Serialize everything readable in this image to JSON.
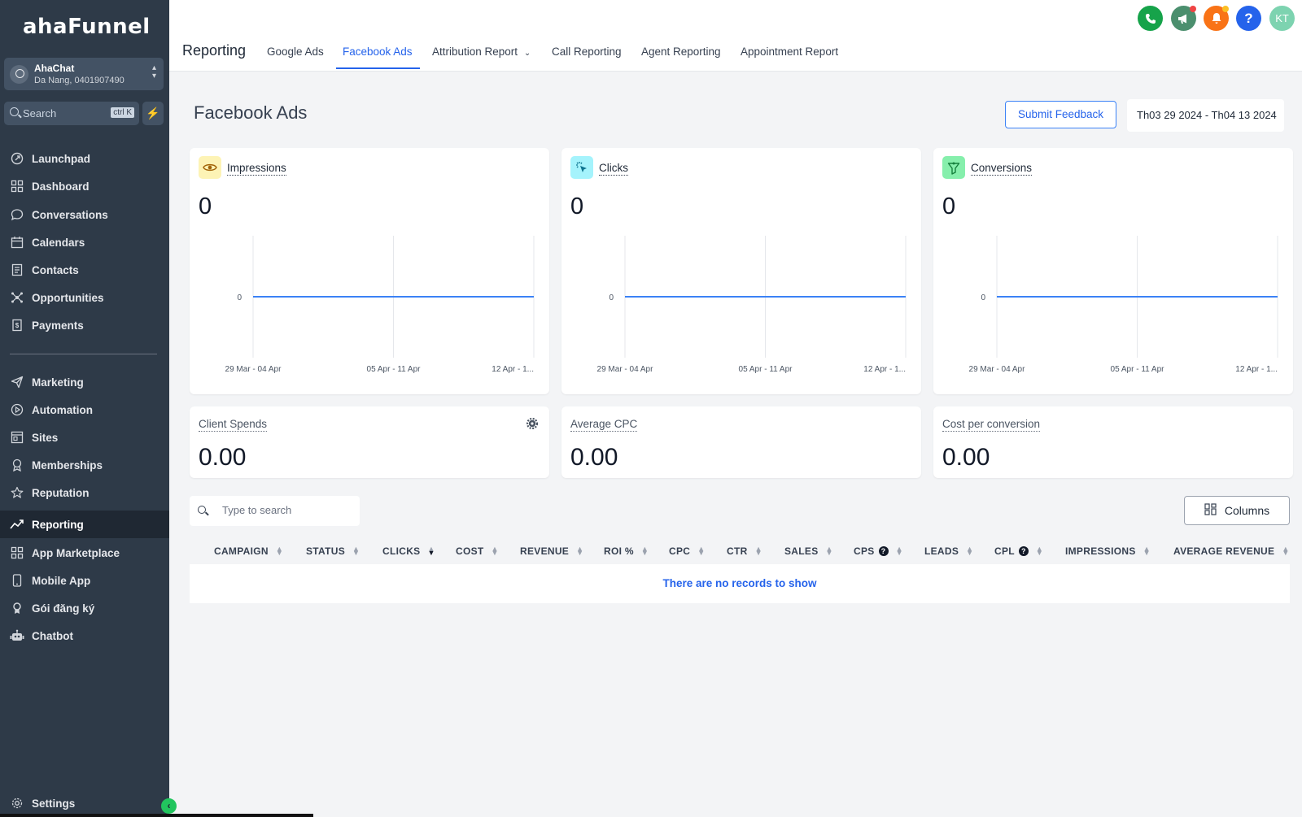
{
  "sidebar": {
    "logo": "ahaFunnel",
    "account": {
      "name": "AhaChat",
      "location": "Da Nang, 0401907490"
    },
    "search": {
      "placeholder": "Search",
      "shortcut": "ctrl K"
    },
    "items": [
      {
        "label": "Launchpad",
        "icon": "rocket-icon"
      },
      {
        "label": "Dashboard",
        "icon": "grid-icon"
      },
      {
        "label": "Conversations",
        "icon": "chat-icon"
      },
      {
        "label": "Calendars",
        "icon": "calendar-icon"
      },
      {
        "label": "Contacts",
        "icon": "contacts-icon"
      },
      {
        "label": "Opportunities",
        "icon": "network-icon"
      },
      {
        "label": "Payments",
        "icon": "receipt-icon"
      },
      {
        "label": "Marketing",
        "icon": "send-icon"
      },
      {
        "label": "Automation",
        "icon": "play-circle-icon"
      },
      {
        "label": "Sites",
        "icon": "browser-icon"
      },
      {
        "label": "Memberships",
        "icon": "award-icon"
      },
      {
        "label": "Reputation",
        "icon": "star-icon"
      },
      {
        "label": "Reporting",
        "icon": "trend-icon"
      },
      {
        "label": "App Marketplace",
        "icon": "apps-icon"
      },
      {
        "label": "Mobile App",
        "icon": "mobile-icon"
      },
      {
        "label": "Gói đăng ký",
        "icon": "badge-icon"
      },
      {
        "label": "Chatbot",
        "icon": "robot-icon"
      }
    ],
    "settings": "Settings"
  },
  "header": {
    "title": "Reporting",
    "tabs": [
      "Google Ads",
      "Facebook Ads",
      "Attribution Report",
      "Call Reporting",
      "Agent Reporting",
      "Appointment Report"
    ],
    "active_tab": "Facebook Ads",
    "avatar_initials": "KT"
  },
  "main": {
    "page_title": "Facebook Ads",
    "feedback_label": "Submit Feedback",
    "date_range": "Th03 29 2024 - Th04 13 2024",
    "metric_cards": [
      {
        "title": "Impressions",
        "value": "0",
        "icon": "eye-icon",
        "icon_bg": "#fdf3b5",
        "icon_color": "#a16207"
      },
      {
        "title": "Clicks",
        "value": "0",
        "icon": "cursor-click-icon",
        "icon_bg": "#a5f3fc",
        "icon_color": "#0e7490"
      },
      {
        "title": "Conversions",
        "value": "0",
        "icon": "funnel-icon",
        "icon_bg": "#86efac",
        "icon_color": "#15803d"
      }
    ],
    "mini_cards": [
      {
        "title": "Client Spends",
        "value": "0.00"
      },
      {
        "title": "Average CPC",
        "value": "0.00"
      },
      {
        "title": "Cost per conversion",
        "value": "0.00"
      }
    ],
    "table": {
      "search_placeholder": "Type to search",
      "columns_label": "Columns",
      "headers": [
        "CAMPAIGN",
        "STATUS",
        "CLICKS",
        "COST",
        "REVENUE",
        "ROI %",
        "CPC",
        "CTR",
        "SALES",
        "CPS",
        "LEADS",
        "CPL",
        "IMPRESSIONS",
        "AVERAGE REVENUE"
      ],
      "empty_message": "There are no records to show"
    }
  },
  "chart_data": [
    {
      "type": "line",
      "categories": [
        "29 Mar - 04 Apr",
        "05 Apr - 11 Apr",
        "12 Apr - 1..."
      ],
      "series": [
        {
          "values": [
            0,
            0,
            0
          ]
        }
      ],
      "yticks": [
        "0"
      ],
      "color": "#3b82f6"
    },
    {
      "type": "line",
      "categories": [
        "29 Mar - 04 Apr",
        "05 Apr - 11 Apr",
        "12 Apr - 1..."
      ],
      "series": [
        {
          "values": [
            0,
            0,
            0
          ]
        }
      ],
      "yticks": [
        "0"
      ],
      "color": "#3b82f6"
    },
    {
      "type": "line",
      "categories": [
        "29 Mar - 04 Apr",
        "05 Apr - 11 Apr",
        "12 Apr - 1..."
      ],
      "series": [
        {
          "values": [
            0,
            0,
            0
          ]
        }
      ],
      "yticks": [
        "0"
      ],
      "color": "#3b82f6"
    }
  ]
}
